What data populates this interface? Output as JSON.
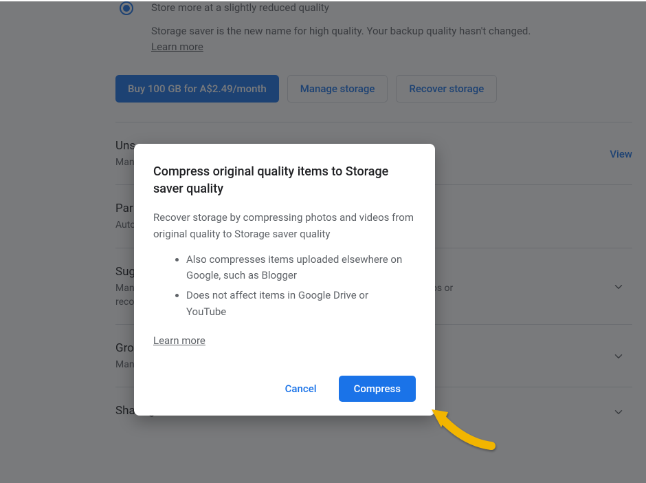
{
  "storageSaver": {
    "line1": "Store more at a slightly reduced quality",
    "line2": "Storage saver is the new name for high quality. Your backup quality hasn't changed.",
    "learnMore": "Learn more"
  },
  "buttons": {
    "buy": "Buy 100 GB for A$2.49/month",
    "manage": "Manage storage",
    "recover": "Recover storage"
  },
  "sections": {
    "unsupported": {
      "title": "Uns",
      "subtitle": "Man",
      "action": "View"
    },
    "partner": {
      "title": "Par",
      "subtitle": "Auto"
    },
    "suggestions": {
      "title": "Sug",
      "subtitle_a": "Man",
      "subtitle_b": "ys photos or",
      "subtitle_c": "reco"
    },
    "group": {
      "title": "Gro",
      "subtitle": "Manage preferences for face grouping"
    },
    "sharing": {
      "title": "Sharing"
    }
  },
  "dialog": {
    "title": "Compress original quality items to Storage saver quality",
    "description": "Recover storage by compressing photos and videos from original quality to Storage saver quality",
    "bullets": [
      "Also compresses items uploaded elsewhere on Google, such as Blogger",
      "Does not affect items in Google Drive or YouTube"
    ],
    "learnMore": "Learn more",
    "cancel": "Cancel",
    "confirm": "Compress"
  }
}
